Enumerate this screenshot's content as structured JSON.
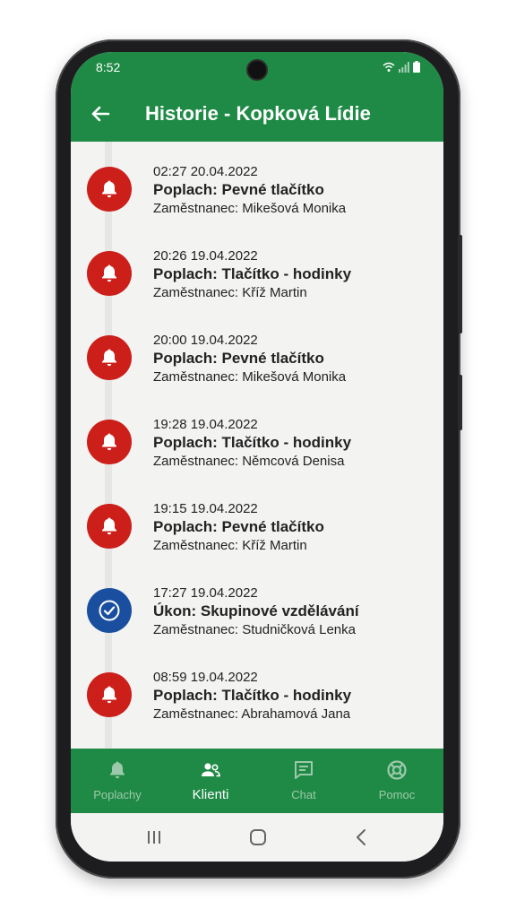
{
  "status": {
    "time": "8:52"
  },
  "header": {
    "title": "Historie - Kopková Lídie"
  },
  "items": [
    {
      "time": "02:27 20.04.2022",
      "title": "Poplach: Pevné tlačítko",
      "employee": "Zaměstnanec: Mikešová Monika",
      "kind": "alarm"
    },
    {
      "time": "20:26 19.04.2022",
      "title": "Poplach: Tlačítko - hodinky",
      "employee": "Zaměstnanec: Kříž Martin",
      "kind": "alarm"
    },
    {
      "time": "20:00 19.04.2022",
      "title": "Poplach: Pevné tlačítko",
      "employee": "Zaměstnanec: Mikešová Monika",
      "kind": "alarm"
    },
    {
      "time": "19:28 19.04.2022",
      "title": "Poplach: Tlačítko - hodinky",
      "employee": "Zaměstnanec: Němcová Denisa",
      "kind": "alarm"
    },
    {
      "time": "19:15 19.04.2022",
      "title": "Poplach: Pevné tlačítko",
      "employee": "Zaměstnanec: Kříž Martin",
      "kind": "alarm"
    },
    {
      "time": "17:27 19.04.2022",
      "title": "Úkon: Skupinové vzdělávání",
      "employee": "Zaměstnanec: Studničková Lenka",
      "kind": "task"
    },
    {
      "time": "08:59 19.04.2022",
      "title": "Poplach: Tlačítko - hodinky",
      "employee": "Zaměstnanec:  Abrahamová Jana",
      "kind": "alarm"
    }
  ],
  "nav": [
    {
      "label": "Poplachy",
      "icon": "bell-icon",
      "active": false
    },
    {
      "label": "Klienti",
      "icon": "users-icon",
      "active": true
    },
    {
      "label": "Chat",
      "icon": "chat-icon",
      "active": false
    },
    {
      "label": "Pomoc",
      "icon": "lifebuoy-icon",
      "active": false
    }
  ],
  "colors": {
    "primary": "#1f8a45",
    "alarm": "#cc1f1a",
    "task": "#1a4fa0",
    "background": "#f3f3f2"
  }
}
